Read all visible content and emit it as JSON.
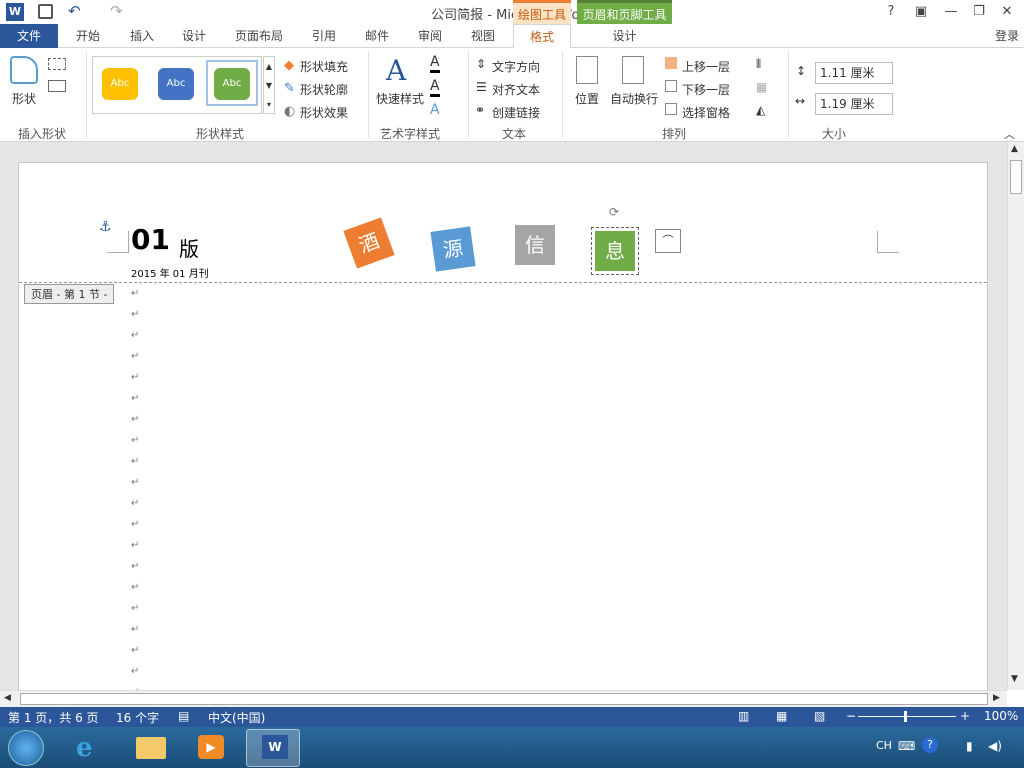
{
  "titlebar": {
    "title": "公司简报 - Microsoft Word",
    "ctx_drawing": "绘图工具",
    "ctx_header": "页眉和页脚工具",
    "help": "?",
    "signin": "登录"
  },
  "tabs": [
    "文件",
    "开始",
    "插入",
    "设计",
    "页面布局",
    "引用",
    "邮件",
    "审阅",
    "视图",
    "格式",
    "设计"
  ],
  "ribbon": {
    "insert_shape": {
      "btn": "形状",
      "label": "插入形状"
    },
    "shape_styles": {
      "swatches": [
        {
          "text": "Abc",
          "color": "#ffc000"
        },
        {
          "text": "Abc",
          "color": "#4472c4"
        },
        {
          "text": "Abc",
          "color": "#70ad47"
        }
      ],
      "fill": "形状填充",
      "outline": "形状轮廓",
      "effect": "形状效果",
      "label": "形状样式"
    },
    "wordart": {
      "quick": "快速样式",
      "label": "艺术字样式"
    },
    "text": {
      "direction": "文字方向",
      "align": "对齐文本",
      "link": "创建链接",
      "label": "文本"
    },
    "arrange": {
      "position": "位置",
      "wrap": "自动换行",
      "forward": "上移一层",
      "backward": "下移一层",
      "pane": "选择窗格",
      "label": "排列"
    },
    "size": {
      "height": "1.11 厘米",
      "width": "1.19 厘米",
      "label": "大小"
    }
  },
  "document": {
    "title_num": "01",
    "title_ver": "版",
    "date": "2015 年 01 月刊",
    "header_tag": "页眉 - 第 1 节 -",
    "tiles": [
      {
        "text": "酒",
        "color": "#ed7d31"
      },
      {
        "text": "源",
        "color": "#5b9bd5"
      },
      {
        "text": "信",
        "color": "#a5a5a5"
      },
      {
        "text": "息",
        "color": "#70ad47"
      }
    ],
    "para_mark": "↵"
  },
  "status": {
    "page": "第 1 页，共 6 页",
    "words": "16 个字",
    "lang": "中文(中国)",
    "zoom": "100%"
  },
  "taskbar": {
    "lang": "CH"
  }
}
